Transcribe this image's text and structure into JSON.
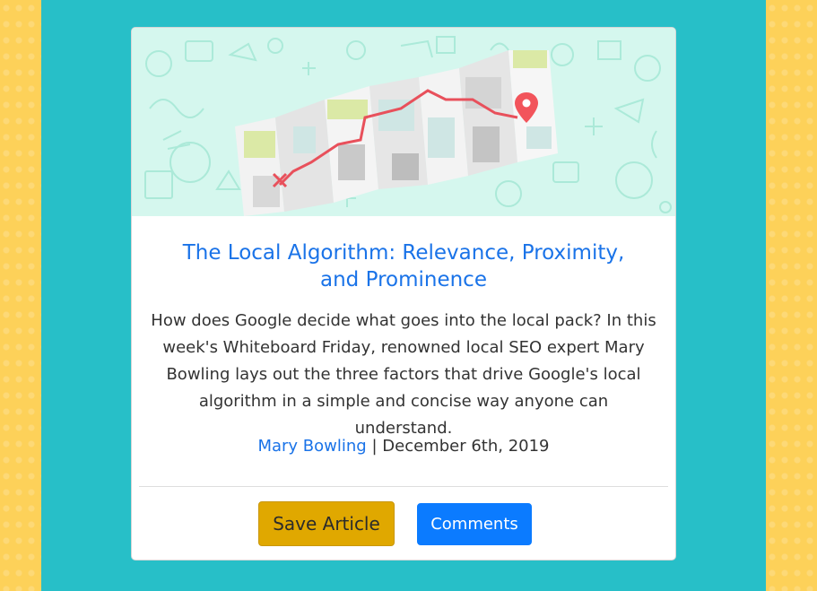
{
  "article": {
    "title_line1": "The Local Algorithm: Relevance, Proximity,",
    "title_line2": "and Prominence",
    "summary": "How does Google decide what goes into the local pack? In this week's Whiteboard Friday, renowned local SEO expert Mary Bowling lays out the three factors that drive Google's local algorithm in a simple and concise way anyone can understand.",
    "author": "Mary Bowling",
    "separator": "|",
    "date": "December 6th, 2019"
  },
  "actions": {
    "save_label": "Save Article",
    "comments_label": "Comments"
  },
  "hero_image": {
    "icon": "folded-map-with-route-and-pin-icon"
  },
  "colors": {
    "page_side": "#fdd159",
    "panel": "#27bfc8",
    "card": "#ffffff",
    "link": "#1a73e8",
    "save_button": "#e0a800",
    "comments_button": "#0b7bff",
    "hero_bg": "#d5f7ee",
    "route": "#e8505b"
  }
}
